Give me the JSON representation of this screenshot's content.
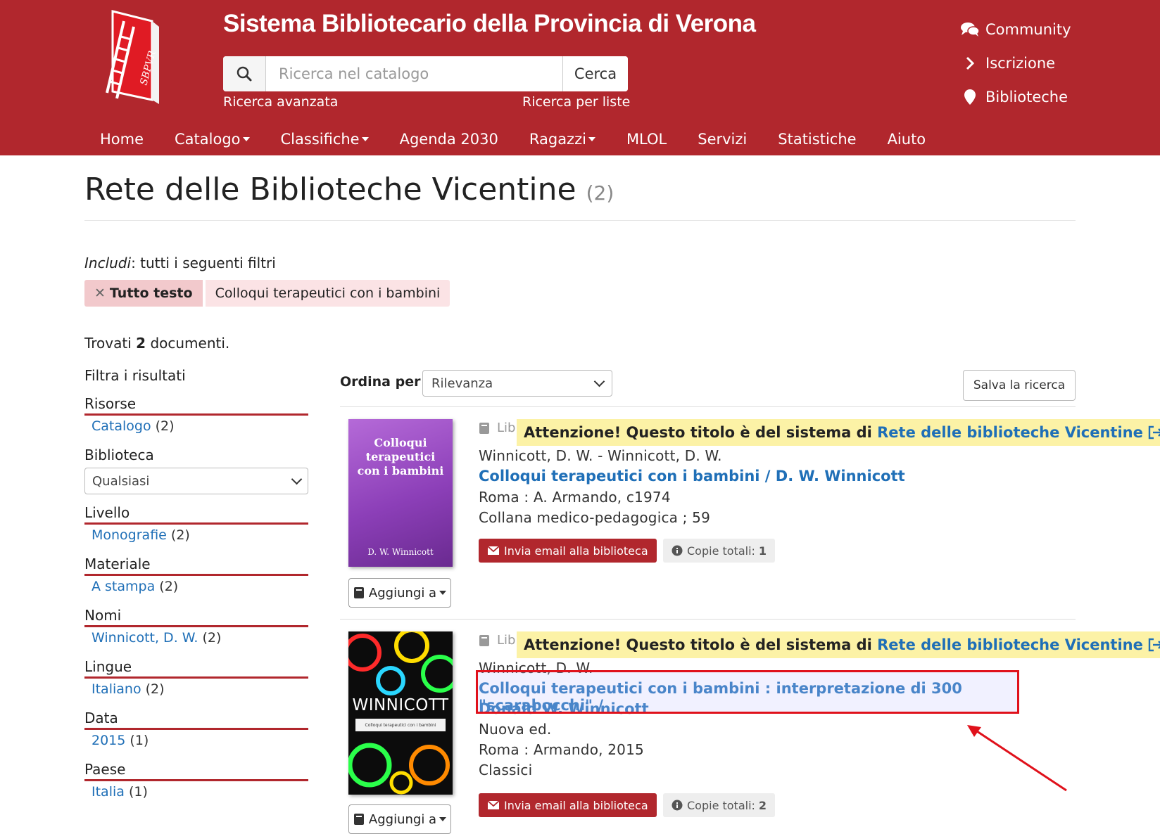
{
  "header": {
    "site_title": "Sistema Bibliotecario della Provincia di Verona",
    "logo_text": "SBPVR",
    "search": {
      "placeholder": "Ricerca nel catalogo",
      "value": "",
      "button": "Cerca"
    },
    "advanced_link": "Ricerca avanzata",
    "lists_link": "Ricerca per liste",
    "right_links": [
      "Community",
      "Iscrizione",
      "Biblioteche"
    ],
    "nav": [
      "Home",
      "Catalogo",
      "Classifiche",
      "Agenda 2030",
      "Ragazzi",
      "MLOL",
      "Servizi",
      "Statistiche",
      "Aiuto"
    ],
    "colors": {
      "brand": "#b1272d"
    }
  },
  "page": {
    "title": "Rete delle Biblioteche Vicentine",
    "count": "(2)",
    "include_label": "Includi",
    "include_text": ": tutti i seguenti filtri",
    "filter_key": "Tutto testo",
    "filter_value": "Colloqui terapeutici con i bambini",
    "found_pre": "Trovati",
    "found_num": "2",
    "found_post": "documenti."
  },
  "sidebar": {
    "title": "Filtra i risultati",
    "risorse": {
      "heading": "Risorse",
      "item": "Catalogo",
      "count": "(2)"
    },
    "biblioteca": {
      "heading": "Biblioteca",
      "select": "Qualsiasi"
    },
    "livello": {
      "heading": "Livello",
      "item": "Monografie",
      "count": "(2)"
    },
    "materiale": {
      "heading": "Materiale",
      "item": "A stampa",
      "count": "(2)"
    },
    "nomi": {
      "heading": "Nomi",
      "item": "Winnicott, D. W.",
      "count": "(2)"
    },
    "lingue": {
      "heading": "Lingue",
      "item": "Italiano",
      "count": "(2)"
    },
    "data": {
      "heading": "Data",
      "item": "2015",
      "count": "(1)"
    },
    "paese": {
      "heading": "Paese",
      "item": "Italia",
      "count": "(1)"
    }
  },
  "results": {
    "sort_label": "Ordina per",
    "sort_value": "Rilevanza",
    "save_button": "Salva la ricerca",
    "type_label": "Lib",
    "notice_text": "Attenzione! Questo titolo è del sistema di",
    "notice_link": "Rete delle biblioteche Vicentine",
    "email_button": "Invia email alla biblioteca",
    "copies_label": "Copie totali:",
    "add_button": "Aggiungi a",
    "items": [
      {
        "cover_title": "Colloqui terapeutici con i bambini",
        "cover_author": "D. W. Winnicott",
        "author": "Winnicott, D. W. - Winnicott, D. W.",
        "title": "Colloqui terapeutici con i bambini / D. W. Winnicott",
        "publication": "Roma : A. Armando, c1974",
        "series": "Collana medico-pedagogica ; 59",
        "copies": "1"
      },
      {
        "cover_title": "WINNICOTT",
        "cover_subtitle": "Colloqui terapeutici con i bambini",
        "author": "Winnicott, D. W.",
        "title_line1": "Colloqui terapeutici con i bambini : interpretazione di 300 \"scarabocchi\" /",
        "title_line2": "Donald W. Winnicott",
        "edition": "Nuova ed.",
        "publication": "Roma : Armando, 2015",
        "series": "Classici",
        "copies": "2"
      }
    ]
  }
}
